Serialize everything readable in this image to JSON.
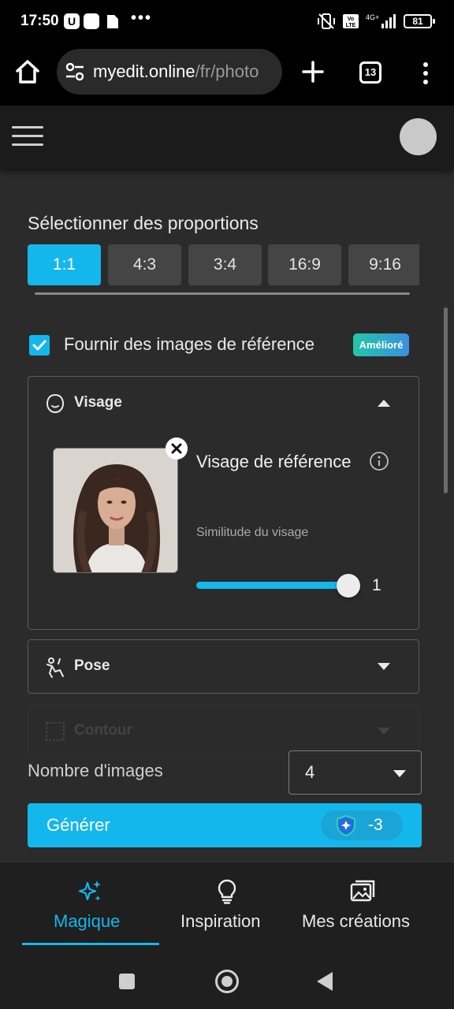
{
  "status_bar": {
    "time": "17:50",
    "notification_icons": [
      "u-app-icon",
      "square-app-icon",
      "document-icon",
      "more-dots-icon"
    ],
    "more": "•••",
    "u_glyph": "U",
    "right_icons": [
      "vibrate-off-icon",
      "volte-icon",
      "signal-4g-icon"
    ],
    "battery": "81"
  },
  "browser": {
    "url_domain": "myedit.online",
    "url_path": "/fr/photo",
    "tab_count": "13"
  },
  "settings": {
    "proportions_title": "Sélectionner des proportions",
    "ratios": [
      {
        "label": "1:1",
        "active": true
      },
      {
        "label": "4:3",
        "active": false
      },
      {
        "label": "3:4",
        "active": false
      },
      {
        "label": "16:9",
        "active": false
      },
      {
        "label": "9:16",
        "active": false
      }
    ],
    "reference": {
      "checkbox_checked": true,
      "label": "Fournir des images de référence",
      "badge": "Amélioré"
    },
    "face_panel": {
      "title": "Visage",
      "ref_title": "Visage de référence",
      "similarity_label": "Similitude du visage",
      "similarity_value": "1",
      "slider_fraction": 1.0
    },
    "pose_panel": {
      "title": "Pose"
    },
    "contour_panel": {
      "title": "Contour"
    },
    "image_count": {
      "label": "Nombre d'images",
      "value": "4"
    },
    "generate": {
      "label": "Générer",
      "credits": "-3"
    }
  },
  "bottom_nav": [
    {
      "label": "Magique",
      "icon": "sparkles-icon",
      "active": true
    },
    {
      "label": "Inspiration",
      "icon": "lightbulb-icon",
      "active": false
    },
    {
      "label": "Mes créations",
      "icon": "gallery-icon",
      "active": false
    }
  ],
  "colors": {
    "accent": "#14b7ec",
    "background": "#2b2b2b",
    "header": "#1b1b1b",
    "nav": "#1f1f1f"
  }
}
